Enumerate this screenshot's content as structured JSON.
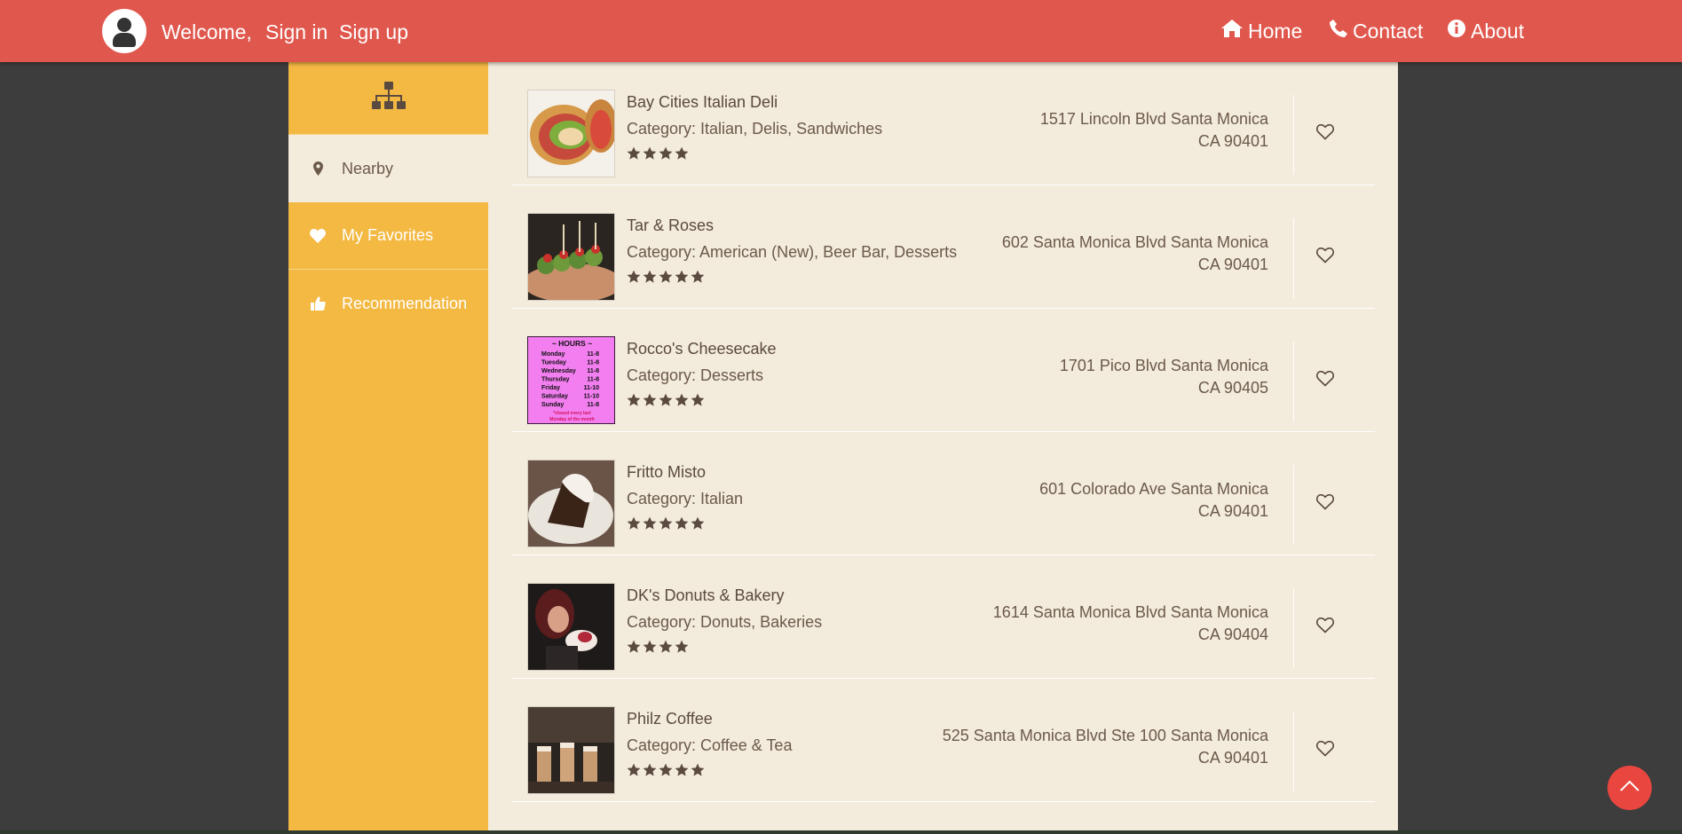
{
  "header": {
    "welcome": "Welcome,",
    "sign_in": "Sign in",
    "sign_up": "Sign up",
    "nav": [
      {
        "label": "Home",
        "icon": "home-icon"
      },
      {
        "label": "Contact",
        "icon": "phone-icon"
      },
      {
        "label": "About",
        "icon": "info-icon"
      }
    ]
  },
  "sidebar": {
    "top_icon": "sitemap-icon",
    "items": [
      {
        "label": "Nearby",
        "icon": "map-marker-icon",
        "active": true
      },
      {
        "label": "My Favorites",
        "icon": "heart-icon",
        "active": false
      },
      {
        "label": "Recommendation",
        "icon": "thumbs-up-icon",
        "active": false
      }
    ]
  },
  "restaurants": [
    {
      "name": "Bay Cities Italian Deli",
      "category": "Category: Italian, Delis, Sandwiches",
      "rating": 4,
      "address_line1": "1517 Lincoln Blvd Santa Monica",
      "address_line2": "CA 90401"
    },
    {
      "name": "Tar & Roses",
      "category": "Category: American (New), Beer Bar, Desserts",
      "rating": 5,
      "address_line1": "602 Santa Monica Blvd Santa Monica",
      "address_line2": "CA 90401"
    },
    {
      "name": "Rocco's Cheesecake",
      "category": "Category: Desserts",
      "rating": 5,
      "address_line1": "1701 Pico Blvd Santa Monica",
      "address_line2": "CA 90405",
      "hours_sign": {
        "title": "~ HOURS ~",
        "lines": [
          [
            "Monday",
            "11-8"
          ],
          [
            "Tuesday",
            "11-8"
          ],
          [
            "Wednesday",
            "11-8"
          ],
          [
            "Thursday",
            "11-8"
          ],
          [
            "Friday",
            "11-10"
          ],
          [
            "Saturday",
            "11-10"
          ],
          [
            "Sunday",
            "11-8"
          ]
        ],
        "note1": "*closed every last",
        "note2": "Monday of the month"
      }
    },
    {
      "name": "Fritto Misto",
      "category": "Category: Italian",
      "rating": 5,
      "address_line1": "601 Colorado Ave Santa Monica",
      "address_line2": "CA 90401"
    },
    {
      "name": "DK's Donuts & Bakery",
      "category": "Category: Donuts, Bakeries",
      "rating": 4,
      "address_line1": "1614 Santa Monica Blvd Santa Monica",
      "address_line2": "CA 90404"
    },
    {
      "name": "Philz Coffee",
      "category": "Category: Coffee & Tea",
      "rating": 5,
      "address_line1": "525 Santa Monica Blvd Ste 100 Santa Monica",
      "address_line2": "CA 90401"
    }
  ],
  "colors": {
    "header": "#e0574d",
    "sidebar": "#f3b943",
    "content": "#f3ebdc",
    "text": "#5a4a3f",
    "scroll_button": "#e8463f"
  }
}
